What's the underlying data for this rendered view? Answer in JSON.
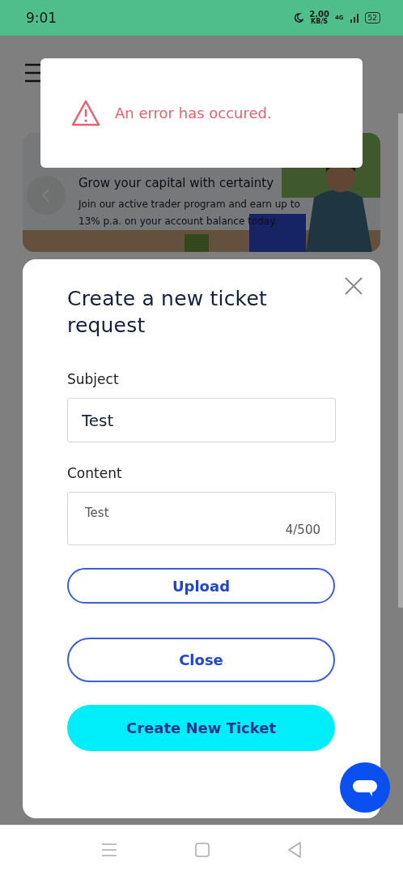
{
  "status_bar": {
    "time": "9:01",
    "speed": "2.00",
    "speed_unit": "KB/S",
    "network": "4G",
    "battery": "52"
  },
  "banner": {
    "headline": "Grow your capital with certainty",
    "body": "Join our active trader program and earn up to 13% p.a. on your account balance today."
  },
  "toast": {
    "message": "An error has occured."
  },
  "modal": {
    "title": "Create a new ticket request",
    "fields": [
      {
        "kind": "input",
        "label": "Subject",
        "value": "Test"
      },
      {
        "kind": "textarea",
        "label": "Content",
        "value": "Test",
        "counter": "4/500"
      }
    ],
    "buttons": [
      {
        "kind": "outline",
        "label": "Upload"
      },
      {
        "kind": "outline",
        "label": "Close"
      },
      {
        "kind": "primary",
        "label": "Create New Ticket"
      }
    ]
  }
}
